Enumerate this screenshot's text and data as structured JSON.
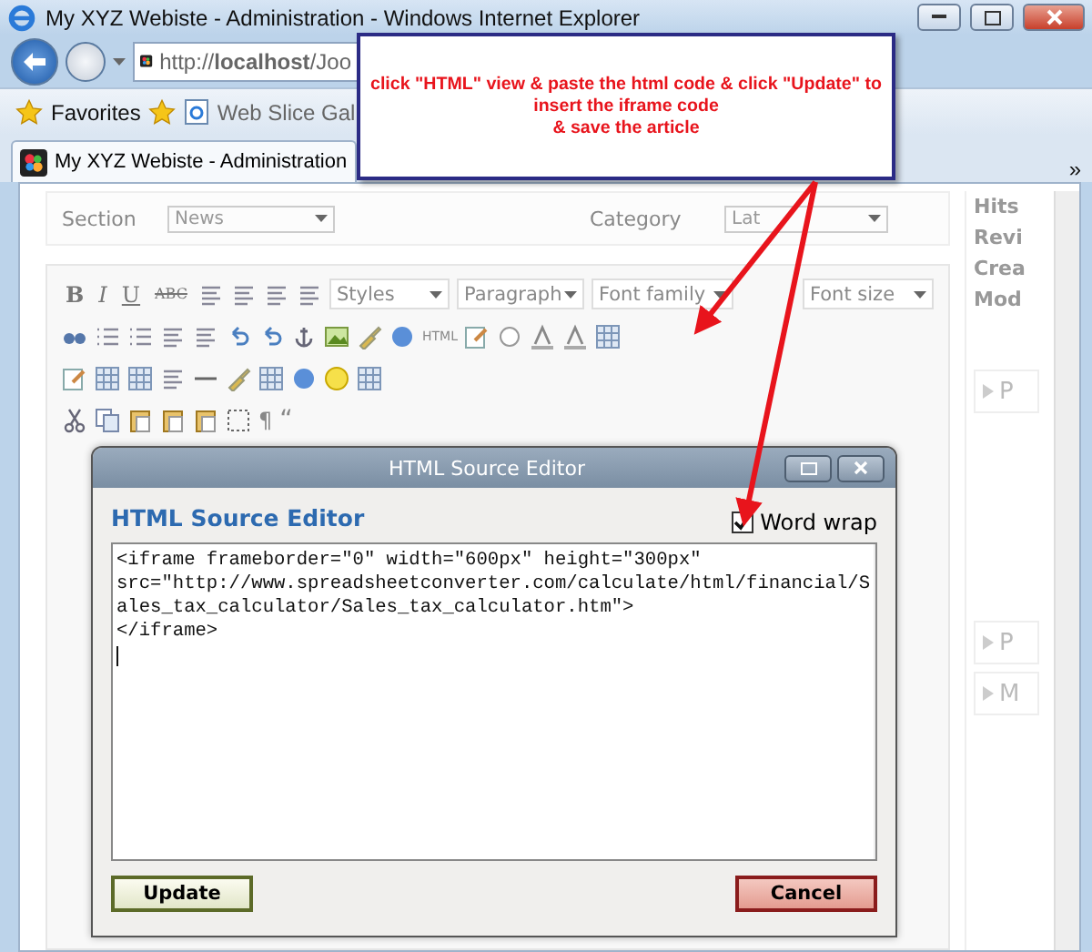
{
  "window": {
    "title": "My XYZ Webiste - Administration - Windows Internet Explorer"
  },
  "address_bar": {
    "value": "http://**localhost**/Joo"
  },
  "favorites_bar": {
    "favorites": "Favorites",
    "web_slice": "Web Slice Gal"
  },
  "tabs": [
    {
      "label": "My XYZ Webiste - Administration",
      "selected": true
    }
  ],
  "tab_overflow": "»",
  "form": {
    "section_label": "Section",
    "section_value": "News",
    "category_label": "Category",
    "category_value": "Lat"
  },
  "sidebar": {
    "items": [
      "Hits",
      "Revi",
      "Crea",
      "Mod"
    ],
    "panels": [
      "P",
      "P",
      "M"
    ]
  },
  "editor_toolbar": {
    "format_buttons": [
      {
        "label": "B",
        "kind": "bold"
      },
      {
        "label": "I",
        "kind": "italic"
      },
      {
        "label": "U",
        "kind": "underline"
      },
      {
        "label": "ABC",
        "kind": "strike"
      }
    ],
    "dropdowns": [
      "Styles",
      "Paragraph",
      "Font family",
      "Font size"
    ],
    "html_button": "HTML",
    "pilcrow": "¶",
    "quote": "“"
  },
  "dialog": {
    "title": "HTML Source Editor",
    "heading": "HTML Source Editor",
    "word_wrap": {
      "label": "Word wrap",
      "checked": true
    },
    "source": "<iframe frameborder=\"0\" width=\"600px\" height=\"300px\" src=\"http://www.spreadsheetconverter.com/calculate/html/financial/Sales_tax_calculator/Sales_tax_calculator.htm\">\n</iframe>",
    "buttons": [
      "Update",
      "Cancel"
    ]
  },
  "callout": {
    "lines": [
      "click \"HTML\" view & paste the html code & click \"Update\" to",
      "insert the iframe code",
      "& save the article"
    ]
  }
}
